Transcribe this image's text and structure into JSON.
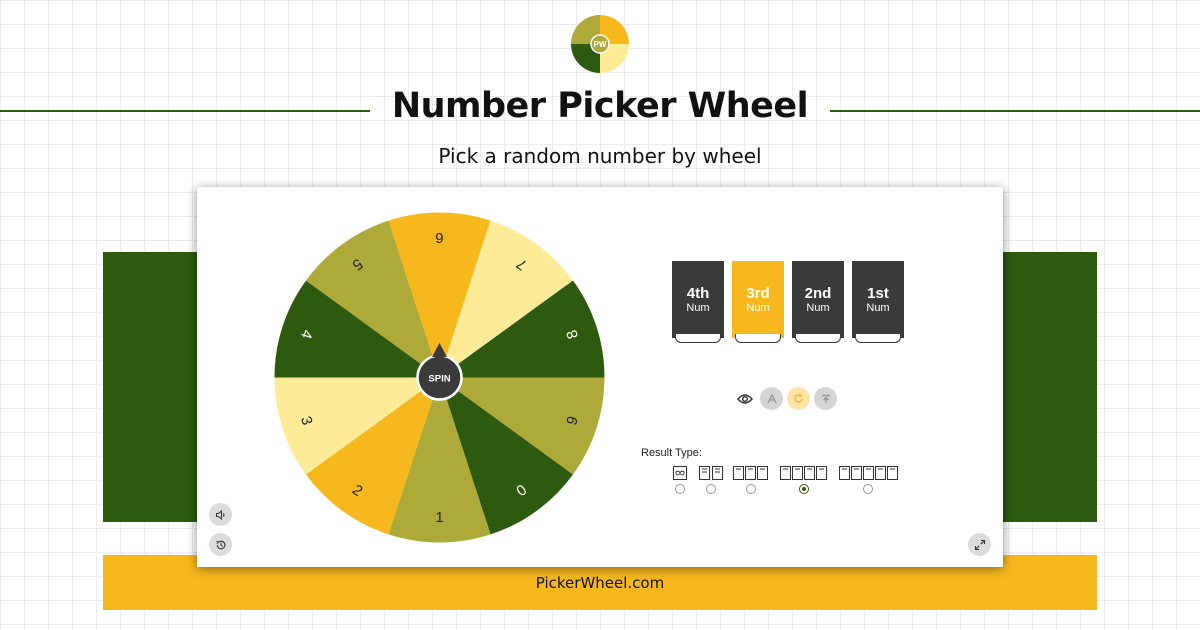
{
  "header": {
    "logo_text": "PW",
    "title": "Number Picker Wheel",
    "subtitle": "Pick a random number by wheel"
  },
  "wheel": {
    "spin_label": "SPIN",
    "segments": [
      {
        "label": "6",
        "color": "#f7b81e"
      },
      {
        "label": "7",
        "color": "#fdeb97"
      },
      {
        "label": "8",
        "color": "#2d5a0e"
      },
      {
        "label": "9",
        "color": "#adaa3a"
      },
      {
        "label": "0",
        "color": "#2d5a0e"
      },
      {
        "label": "1",
        "color": "#adaa3a"
      },
      {
        "label": "2",
        "color": "#f7b81e"
      },
      {
        "label": "3",
        "color": "#fdeb97"
      },
      {
        "label": "4",
        "color": "#2d5a0e"
      },
      {
        "label": "5",
        "color": "#adaa3a"
      }
    ]
  },
  "digit_places": [
    {
      "big": "4th",
      "small": "Num",
      "active": false
    },
    {
      "big": "3rd",
      "small": "Num",
      "active": true
    },
    {
      "big": "2nd",
      "small": "Num",
      "active": false
    },
    {
      "big": "1st",
      "small": "Num",
      "active": false
    }
  ],
  "result_type": {
    "label": "Result Type:",
    "options": [
      "∞",
      "2 digits",
      "3 digits",
      "4 digits",
      "5 digits"
    ],
    "selected_index": 3
  },
  "footer": {
    "text": "PickerWheel.com"
  },
  "colors": {
    "dark_green": "#2d5a0e",
    "olive": "#adaa3a",
    "amber": "#f7b81e",
    "light_yellow": "#fdeb97",
    "dark_gray": "#3a3a3a"
  },
  "icons": {
    "sound": "speaker-icon",
    "history": "history-icon",
    "fullscreen": "fullscreen-icon",
    "view": "eye-icon"
  }
}
